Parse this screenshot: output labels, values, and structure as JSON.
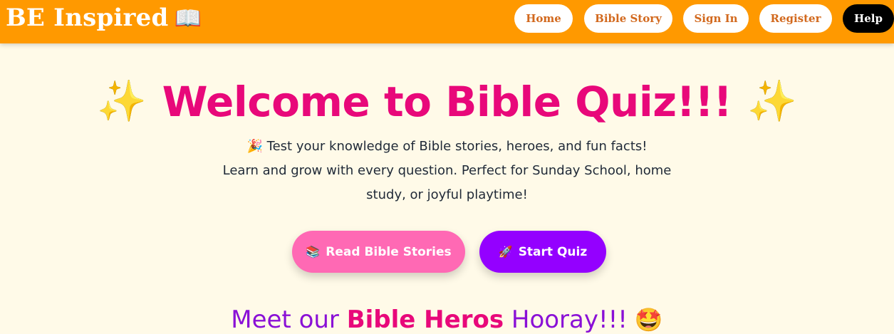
{
  "header": {
    "brand": "BE Inspired",
    "brand_icon": "📖",
    "nav": [
      {
        "label": "Home"
      },
      {
        "label": "Bible Story"
      },
      {
        "label": "Sign In"
      },
      {
        "label": "Register"
      },
      {
        "label": "Help"
      }
    ]
  },
  "hero": {
    "sparkle_left": "✨",
    "title": "Welcome to Bible Quiz!!!",
    "sparkle_right": "✨",
    "desc_icon": "🎉",
    "desc_line1": "Test your knowledge of Bible stories, heroes, and fun facts!",
    "desc_line2": "Learn and grow with every question. Perfect for Sunday School, home",
    "desc_line3": "study, or joyful playtime!",
    "buttons": {
      "read": {
        "icon": "📚",
        "label": "Read Bible Stories"
      },
      "quiz": {
        "icon": "🚀",
        "label": "Start Quiz"
      }
    }
  },
  "heroes": {
    "prefix": "Meet our",
    "accent": "Bible Heros",
    "suffix": "Hooray!!!",
    "emoji": "🤩"
  },
  "colors": {
    "header_bg": "#ff9900",
    "page_bg": "#fffae8",
    "title": "#e8087a",
    "heading_purple": "#8a10d6",
    "nav_text": "#d2691e",
    "read_button": "#ff69b4",
    "quiz_button": "#9400ff"
  }
}
